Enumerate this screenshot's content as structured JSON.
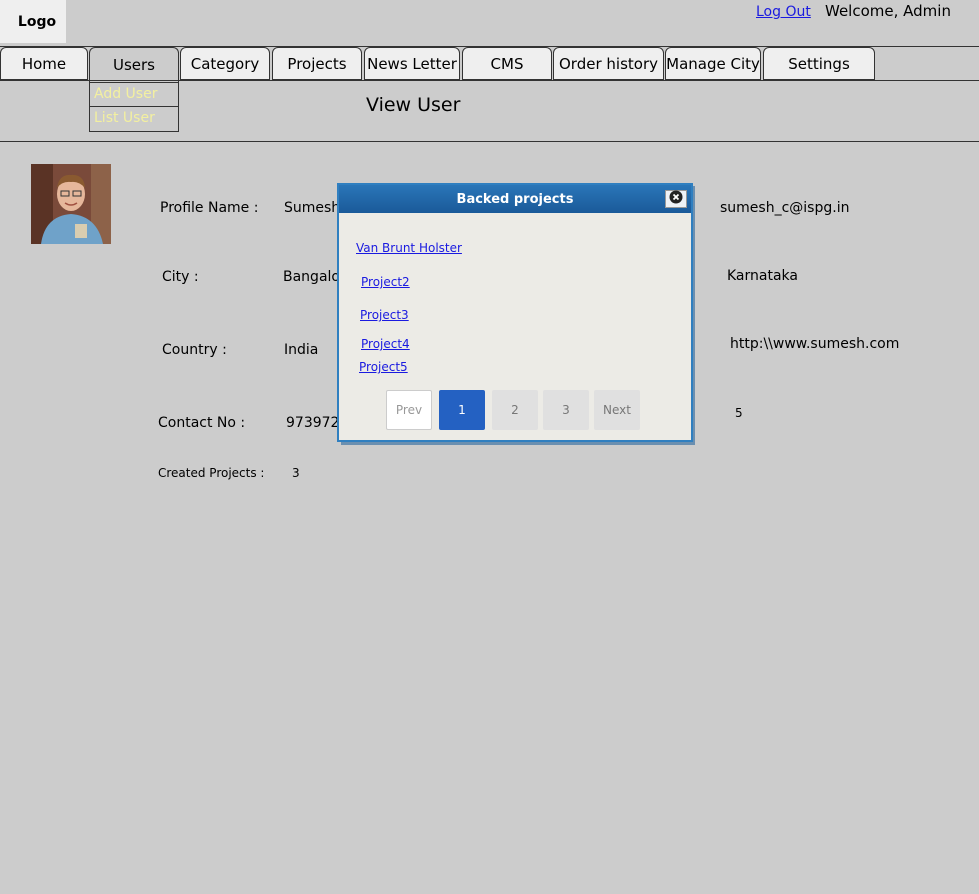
{
  "header": {
    "logo_text": "Logo",
    "logout_label": "Log Out",
    "welcome_text": "Welcome, Admin"
  },
  "nav": {
    "tabs": [
      {
        "label": "Home"
      },
      {
        "label": "Users"
      },
      {
        "label": "Category"
      },
      {
        "label": "Projects"
      },
      {
        "label": "News Letter"
      },
      {
        "label": "CMS"
      },
      {
        "label": "Order history"
      },
      {
        "label": "Manage City"
      },
      {
        "label": "Settings"
      }
    ],
    "active_tab": "Users",
    "dropdown": [
      {
        "label": "Add User"
      },
      {
        "label": "List User"
      }
    ]
  },
  "page": {
    "title": "View User"
  },
  "profile": {
    "name_label": "Profile Name :",
    "name_value": "Sumesh",
    "email_value": "sumesh_c@ispg.in",
    "city_label": "City :",
    "city_value": "Bangalore",
    "state_value": "Karnataka",
    "country_label": "Country :",
    "country_value": "India",
    "website_value": "http:\\\\www.sumesh.com",
    "contact_label": "Contact No :",
    "contact_value": "973972",
    "backed_count": "5",
    "created_label": "Created Projects :",
    "created_value": "3"
  },
  "modal": {
    "title": "Backed projects",
    "projects": [
      "Van Brunt Holster",
      "Project2",
      "Project3",
      "Project4",
      "Project5"
    ],
    "pagination": {
      "prev": "Prev",
      "pages": [
        "1",
        "2",
        "3"
      ],
      "current": "1",
      "next": "Next"
    }
  },
  "colors": {
    "background": "#cccccc",
    "link": "#1a1ae0",
    "modal_header": "#1f66a8",
    "pagination_active": "#2461c2",
    "dropdown_text": "#f3f0a0"
  }
}
